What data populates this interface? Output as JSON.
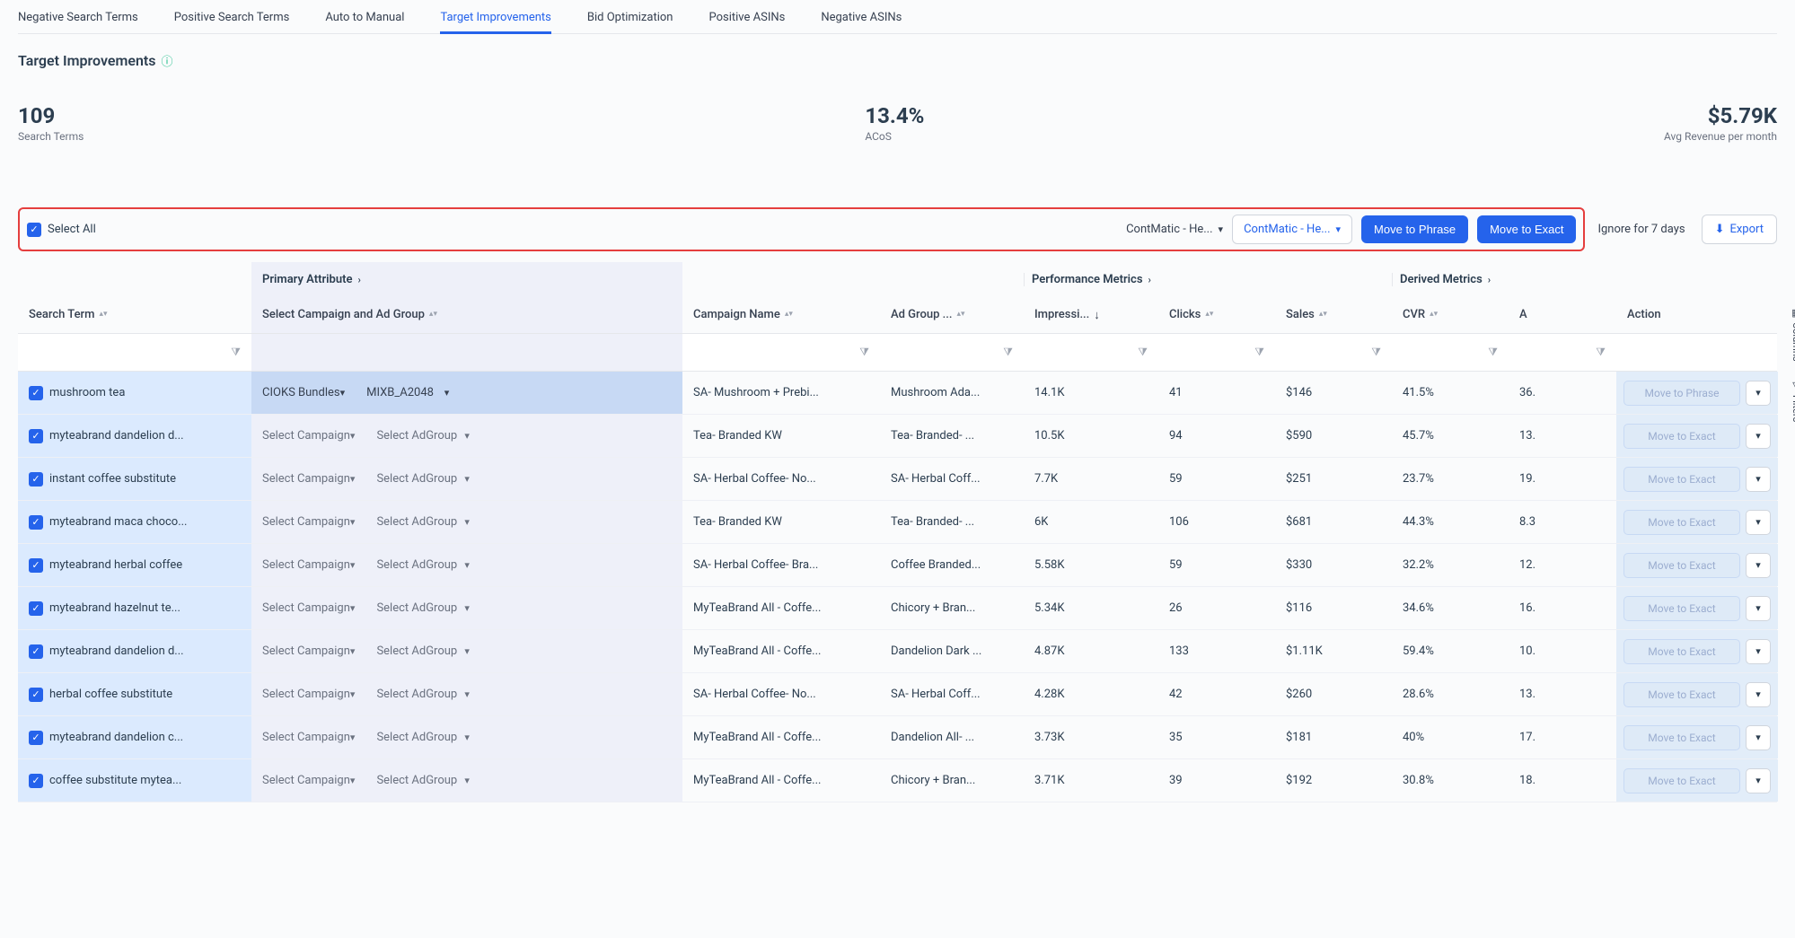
{
  "tabs": {
    "items": [
      {
        "label": "Negative Search Terms",
        "active": false
      },
      {
        "label": "Positive Search Terms",
        "active": false
      },
      {
        "label": "Auto to Manual",
        "active": false
      },
      {
        "label": "Target Improvements",
        "active": true
      },
      {
        "label": "Bid Optimization",
        "active": false
      },
      {
        "label": "Positive ASINs",
        "active": false
      },
      {
        "label": "Negative ASINs",
        "active": false
      }
    ]
  },
  "page_title": "Target Improvements",
  "stats": {
    "search_terms": {
      "value": "109",
      "label": "Search Terms"
    },
    "acos": {
      "value": "13.4%",
      "label": "ACoS"
    },
    "revenue": {
      "value": "$5.79K",
      "label": "Avg Revenue per month"
    }
  },
  "toolbar": {
    "select_all": "Select All",
    "dd1": "ContMatic - He...",
    "dd2": "ContMatic - He...",
    "move_phrase": "Move to Phrase",
    "move_exact": "Move to Exact",
    "ignore": "Ignore for 7 days",
    "export": "Export"
  },
  "groups": {
    "primary": "Primary Attribute",
    "perf": "Performance Metrics",
    "derived": "Derived Metrics"
  },
  "columns": {
    "search_term": "Search Term",
    "select_campaign": "Select Campaign and Ad Group",
    "campaign_name": "Campaign Name",
    "ad_group": "Ad Group ...",
    "impressions": "Impressi...",
    "clicks": "Clicks",
    "sales": "Sales",
    "cvr": "CVR",
    "a": "A",
    "action": "Action"
  },
  "side": {
    "columns": "Columns",
    "filters": "Filters"
  },
  "rows": [
    {
      "term": "mushroom tea",
      "campaign_sel": "CIOKS Bundles",
      "adgroup_sel": "MIXB_A2048",
      "campaign": "SA- Mushroom + Prebi...",
      "adgroup": "Mushroom Ada...",
      "impr": "14.1K",
      "clicks": "41",
      "sales": "$146",
      "cvr": "41.5%",
      "a": "36.",
      "action": "Move to Phrase",
      "selected_row": true
    },
    {
      "term": "myteabrand dandelion d...",
      "campaign_sel": "Select Campaign",
      "adgroup_sel": "Select AdGroup",
      "campaign": "Tea- Branded KW",
      "adgroup": "Tea- Branded- ...",
      "impr": "10.5K",
      "clicks": "94",
      "sales": "$590",
      "cvr": "45.7%",
      "a": "13.",
      "action": "Move to Exact"
    },
    {
      "term": "instant coffee substitute",
      "campaign_sel": "Select Campaign",
      "adgroup_sel": "Select AdGroup",
      "campaign": "SA- Herbal Coffee- No...",
      "adgroup": "SA- Herbal Coff...",
      "impr": "7.7K",
      "clicks": "59",
      "sales": "$251",
      "cvr": "23.7%",
      "a": "19.",
      "action": "Move to Exact"
    },
    {
      "term": "myteabrand maca choco...",
      "campaign_sel": "Select Campaign",
      "adgroup_sel": "Select AdGroup",
      "campaign": "Tea- Branded KW",
      "adgroup": "Tea- Branded- ...",
      "impr": "6K",
      "clicks": "106",
      "sales": "$681",
      "cvr": "44.3%",
      "a": "8.3",
      "action": "Move to Exact"
    },
    {
      "term": "myteabrand herbal coffee",
      "campaign_sel": "Select Campaign",
      "adgroup_sel": "Select AdGroup",
      "campaign": "SA- Herbal Coffee- Bra...",
      "adgroup": "Coffee Branded...",
      "impr": "5.58K",
      "clicks": "59",
      "sales": "$330",
      "cvr": "32.2%",
      "a": "12.",
      "action": "Move to Exact"
    },
    {
      "term": "myteabrand hazelnut te...",
      "campaign_sel": "Select Campaign",
      "adgroup_sel": "Select AdGroup",
      "campaign": "MyTeaBrand All - Coffe...",
      "adgroup": "Chicory + Bran...",
      "impr": "5.34K",
      "clicks": "26",
      "sales": "$116",
      "cvr": "34.6%",
      "a": "16.",
      "action": "Move to Exact"
    },
    {
      "term": "myteabrand dandelion d...",
      "campaign_sel": "Select Campaign",
      "adgroup_sel": "Select AdGroup",
      "campaign": "MyTeaBrand All - Coffe...",
      "adgroup": "Dandelion Dark ...",
      "impr": "4.87K",
      "clicks": "133",
      "sales": "$1.11K",
      "cvr": "59.4%",
      "a": "10.",
      "action": "Move to Exact"
    },
    {
      "term": "herbal coffee substitute",
      "campaign_sel": "Select Campaign",
      "adgroup_sel": "Select AdGroup",
      "campaign": "SA- Herbal Coffee- No...",
      "adgroup": "SA- Herbal Coff...",
      "impr": "4.28K",
      "clicks": "42",
      "sales": "$260",
      "cvr": "28.6%",
      "a": "13.",
      "action": "Move to Exact"
    },
    {
      "term": "myteabrand dandelion c...",
      "campaign_sel": "Select Campaign",
      "adgroup_sel": "Select AdGroup",
      "campaign": "MyTeaBrand All - Coffe...",
      "adgroup": "Dandelion All- ...",
      "impr": "3.73K",
      "clicks": "35",
      "sales": "$181",
      "cvr": "40%",
      "a": "17.",
      "action": "Move to Exact"
    },
    {
      "term": "coffee substitute mytea...",
      "campaign_sel": "Select Campaign",
      "adgroup_sel": "Select AdGroup",
      "campaign": "MyTeaBrand All - Coffe...",
      "adgroup": "Chicory + Bran...",
      "impr": "3.71K",
      "clicks": "39",
      "sales": "$192",
      "cvr": "30.8%",
      "a": "18.",
      "action": "Move to Exact"
    }
  ]
}
